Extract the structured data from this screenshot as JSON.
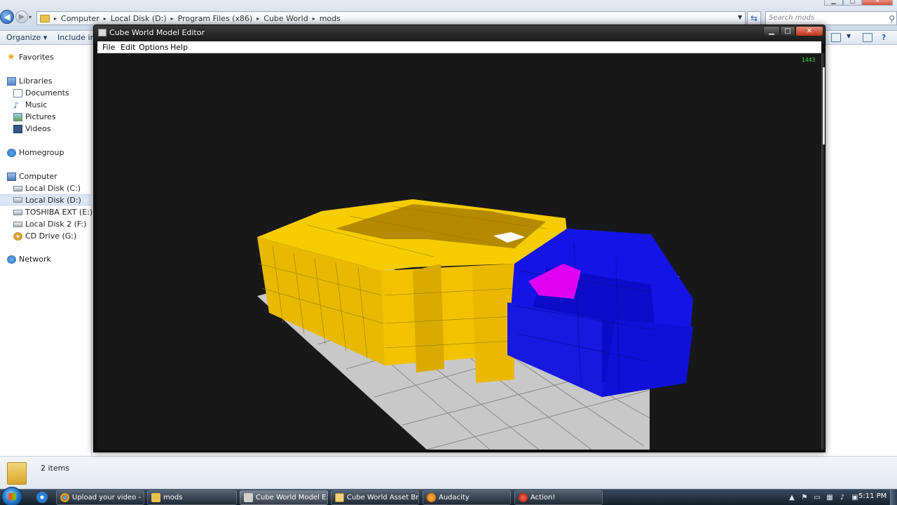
{
  "explorer": {
    "breadcrumb": [
      "Computer",
      "Local Disk (D:)",
      "Program Files (x86)",
      "Cube World",
      "mods"
    ],
    "search_placeholder": "Search mods",
    "toolbar": {
      "organize": "Organize ▾",
      "include": "Include in li"
    },
    "nav": {
      "favorites": "Favorites",
      "libraries": "Libraries",
      "documents": "Documents",
      "music": "Music",
      "pictures": "Pictures",
      "videos": "Videos",
      "homegroup": "Homegroup",
      "computer": "Computer",
      "disk_c": "Local Disk (C:)",
      "disk_d": "Local Disk (D:)",
      "disk_e": "TOSHIBA EXT (E:)",
      "disk_f": "Local Disk 2 (F:)",
      "disk_g": "CD Drive (G:)",
      "network": "Network"
    },
    "status": {
      "items": "2 items"
    }
  },
  "editor": {
    "title": "Cube World Model Editor",
    "menu": {
      "file": "File",
      "edit": "Edit",
      "options": "Options",
      "help": "Help"
    },
    "counter": "1443"
  },
  "taskbar": {
    "tasks": [
      {
        "label": "Upload your video - ..."
      },
      {
        "label": "mods"
      },
      {
        "label": "Cube World Model E..."
      },
      {
        "label": "Cube World Asset Br..."
      },
      {
        "label": "Audacity"
      },
      {
        "label": "Action!"
      }
    ],
    "clock": "5:11 PM"
  },
  "colors": {
    "voxel_yellow": "#f2c200",
    "voxel_blue": "#1414e6",
    "voxel_magenta": "#e000f0",
    "floor_grey": "#c8c8c8",
    "viewport_bg": "#181818"
  }
}
